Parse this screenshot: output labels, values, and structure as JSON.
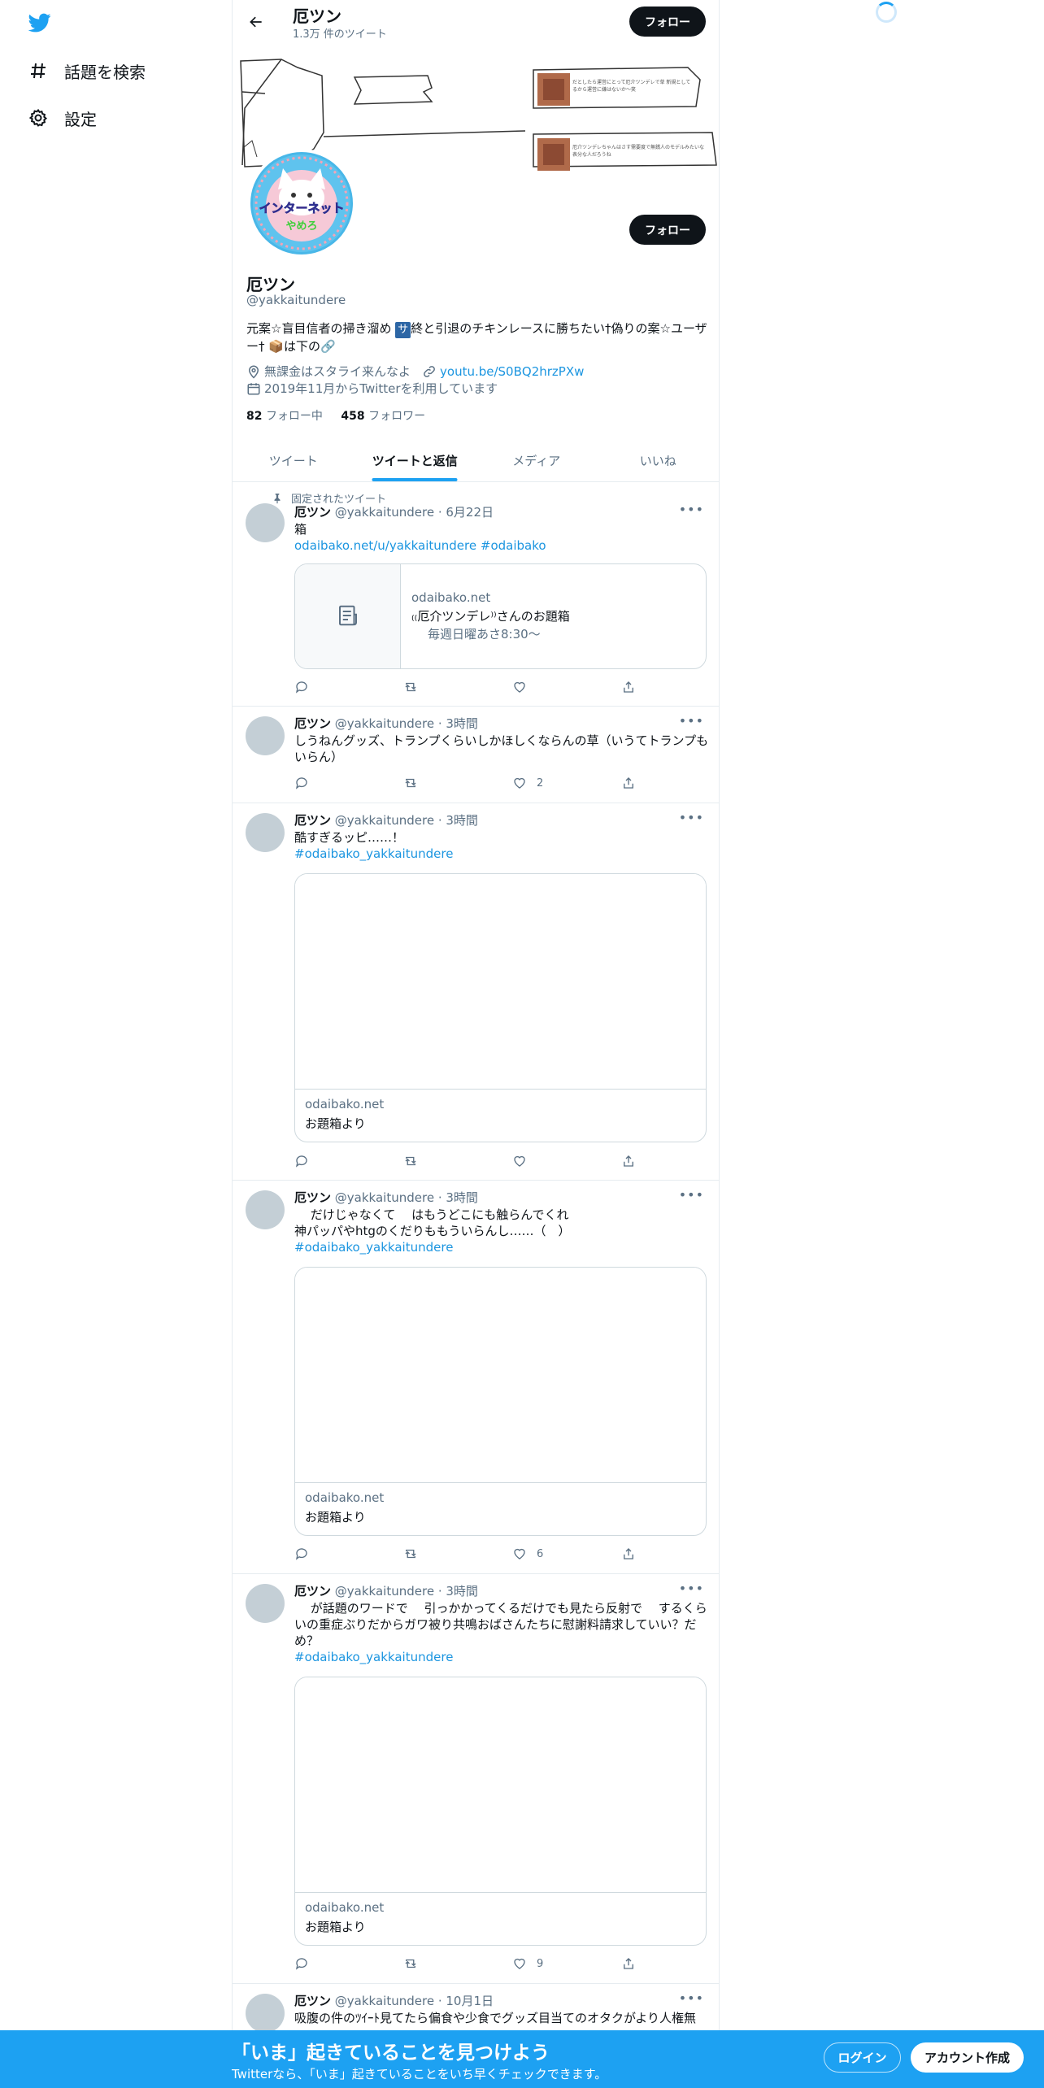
{
  "nav": {
    "items": [
      {
        "label": "話題を検索",
        "icon": "hashtag-icon"
      },
      {
        "label": "設定",
        "icon": "gear-icon"
      }
    ]
  },
  "header": {
    "name": "厄ツン",
    "tweet_count": "1.3万 件のツイート",
    "follow_label": "フォロー"
  },
  "profile": {
    "name": "厄ツン",
    "handle": "@yakkaitundere",
    "bio_part1": "元案☆盲目信者の掃き溜め ",
    "bio_chip": "サ",
    "bio_part2": "終と引退のチキンレースに勝ちたい†偽りの案☆ユーザー† 📦は下の🔗",
    "location": "無課金はスタライ来んなよ",
    "website": "youtu.be/S0BQ2hrzPXw",
    "joined": "2019年11月からTwitterを利用しています",
    "following_count": "82",
    "following_label": "フォロー中",
    "followers_count": "458",
    "followers_label": "フォロワー",
    "follow_label": "フォロー",
    "avatar_text_top": "インターネット",
    "avatar_text_bottom": "やめろ",
    "banner_note1": "だとしたら運営にとって厄介ツンデレで草 新規としてるから運営に嫌はないか～笑",
    "banner_note2": "厄介ツンデレちゃんはさす需要度で無銭人のモデルみたいな表分な人だろうね"
  },
  "tabs": [
    {
      "label": "ツイート",
      "active": false
    },
    {
      "label": "ツイートと返信",
      "active": true
    },
    {
      "label": "メディア",
      "active": false
    },
    {
      "label": "いいね",
      "active": false
    }
  ],
  "pinned_label": "固定されたツイート",
  "tweets": [
    {
      "name": "厄ツン",
      "handle": "@yakkaitundere",
      "time": "6月22日",
      "line1": "箱",
      "link1": "odaibako.net/u/yakkaitundere",
      "link2": "#odaibako",
      "card": {
        "domain": "odaibako.net",
        "title": "₍₍厄介ツンデレ⁾⁾さんのお題箱",
        "desc": "毎週日曜あさ8:30〜"
      },
      "likes": ""
    },
    {
      "name": "厄ツン",
      "handle": "@yakkaitundere",
      "time": "3時間",
      "line1": "しうねんグッズ、トランプくらいしかほしくならんの草（いうてトランプもいらん）",
      "likes": "2"
    },
    {
      "name": "厄ツン",
      "handle": "@yakkaitundere",
      "time": "3時間",
      "line1": "酷すぎるッピ……！",
      "hashtag": "#odaibako_yakkaitundere",
      "card": {
        "domain": "odaibako.net",
        "title": "お題箱より"
      },
      "likes": ""
    },
    {
      "name": "厄ツン",
      "handle": "@yakkaitundere",
      "time": "3時間",
      "line1": "　 だけじゃなくて　 はもうどこにも触らんでくれ",
      "line2": "神パッパやhtgのくだりももういらんし……（　）",
      "hashtag": "#odaibako_yakkaitundere",
      "card": {
        "domain": "odaibako.net",
        "title": "お題箱より"
      },
      "likes": "6"
    },
    {
      "name": "厄ツン",
      "handle": "@yakkaitundere",
      "time": "3時間",
      "line1": "　 が話題のワードで　 引っかかってくるだけでも見たら反射で　 するくらいの重症ぶりだからガワ被り共鳴おばさんたちに慰謝料請求していい？だめ？",
      "hashtag": "#odaibako_yakkaitundere",
      "card": {
        "domain": "odaibako.net",
        "title": "お題箱より"
      },
      "likes": "9"
    },
    {
      "name": "厄ツン",
      "handle": "@yakkaitundere",
      "time": "10月1日",
      "line1": "吸腹の件のﾂｲｰﾄ見てたら偏食や少食でグッズ目当てのオタクがより人権無"
    }
  ],
  "bottom_bar": {
    "title": "「いま」起きていることを見つけよう",
    "subtitle": "Twitterなら、「いま」起きていることをいち早くチェックできます。",
    "login": "ログイン",
    "signup": "アカウント作成"
  },
  "colors": {
    "accent": "#1da1f2",
    "link": "#1b95e0",
    "button_dark": "#0f1419"
  }
}
